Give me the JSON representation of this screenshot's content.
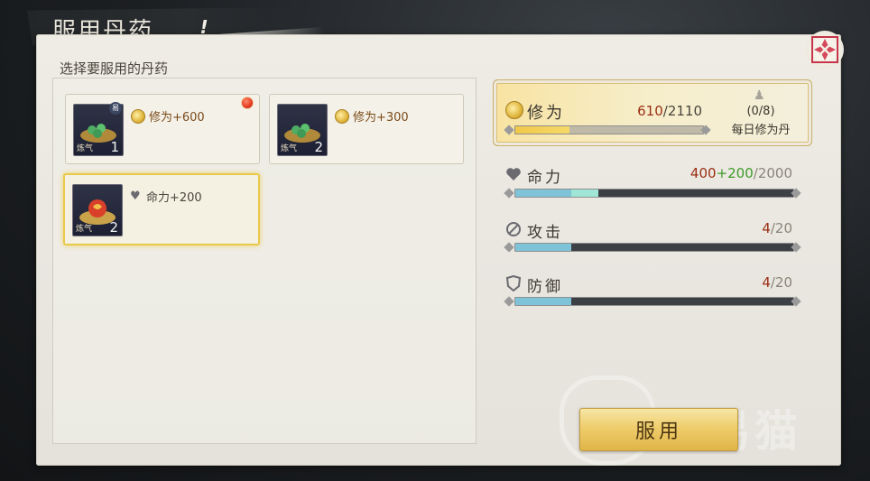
{
  "header": {
    "title": "服用丹药",
    "help_symbol": "!"
  },
  "left_panel": {
    "label": "选择要服用的丹药"
  },
  "pills": [
    {
      "effect": "修为+600",
      "count": "1",
      "tag": "炼气",
      "effect_icon": "xiuwei-icon",
      "badge": "易",
      "has_red_dot": true,
      "selected": false
    },
    {
      "effect": "修为+300",
      "count": "2",
      "tag": "炼气",
      "effect_icon": "xiuwei-icon",
      "selected": false
    },
    {
      "effect": "命力+200",
      "count": "2",
      "tag": "炼气",
      "effect_icon": "heart-icon",
      "selected": true
    }
  ],
  "xiuwei": {
    "label": "修为",
    "current": "610",
    "max": "/2110",
    "fill_fraction": 0.289,
    "daily_count": "(0/8)",
    "daily_name": "每日修为丹"
  },
  "stats": [
    {
      "key": "life",
      "label": "命力",
      "icon": "heart-icon",
      "base": "400",
      "plus": "+200",
      "max": "/2000",
      "fill_fraction": 0.2,
      "add_fraction": 0.1
    },
    {
      "key": "attack",
      "label": "攻击",
      "icon": "sword-icon",
      "base": "4",
      "max": "/20",
      "fill_fraction": 0.2
    },
    {
      "key": "defense",
      "label": "防御",
      "icon": "shield-icon",
      "base": "4",
      "max": "/20",
      "fill_fraction": 0.2
    }
  ],
  "action": {
    "use_label": "服用"
  },
  "watermark": {
    "text": "交易猫"
  },
  "colors": {
    "accent_gold": "#e8c94a",
    "bar_blue": "#7fc3d9",
    "bar_green": "#7cd8c9",
    "value_red": "#9b2e14",
    "value_green": "#3f9a2a"
  }
}
